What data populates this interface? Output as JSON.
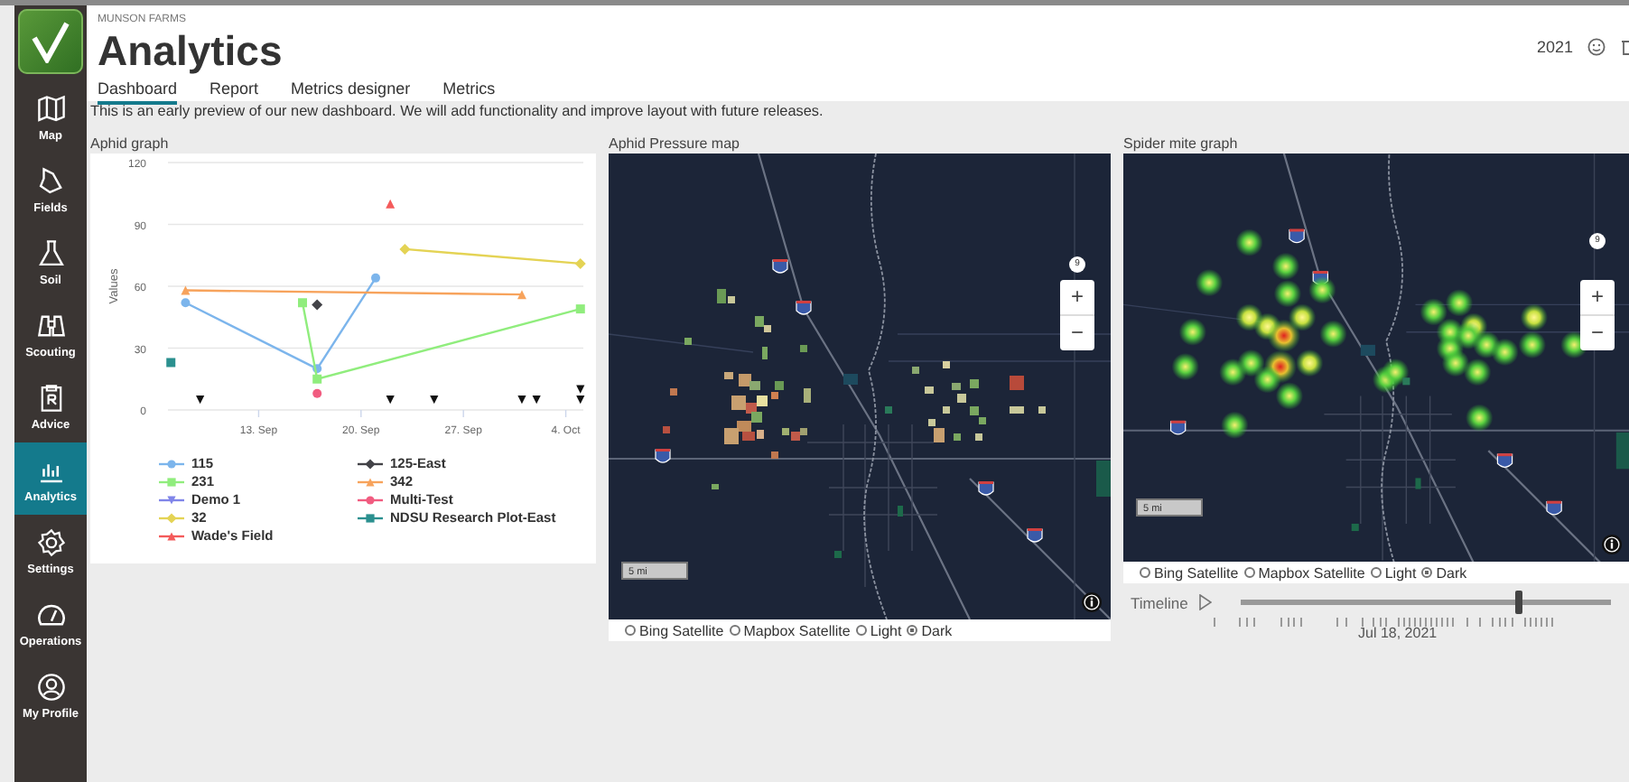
{
  "sidebar": {
    "items": [
      {
        "label": "Map",
        "selected": false
      },
      {
        "label": "Fields",
        "selected": false
      },
      {
        "label": "Soil",
        "selected": false
      },
      {
        "label": "Scouting",
        "selected": false
      },
      {
        "label": "Advice",
        "selected": false
      },
      {
        "label": "Analytics",
        "selected": true
      },
      {
        "label": "Settings",
        "selected": false
      },
      {
        "label": "Operations",
        "selected": false
      },
      {
        "label": "My Profile",
        "selected": false
      }
    ]
  },
  "header": {
    "company": "MUNSON FARMS",
    "title": "Analytics",
    "year": "2021",
    "tabs": [
      {
        "label": "Dashboard",
        "selected": true
      },
      {
        "label": "Report",
        "selected": false
      },
      {
        "label": "Metrics designer",
        "selected": false
      },
      {
        "label": "Metrics",
        "selected": false
      }
    ]
  },
  "notice": "This is an early preview of our new dashboard. We will add functionality and improve layout with future releases.",
  "aphid_graph": {
    "title": "Aphid graph",
    "chart_data": {
      "type": "line",
      "ylabel": "Values",
      "categories": [
        null,
        null,
        null,
        null,
        null,
        null,
        "13. Sep",
        null,
        null,
        null,
        null,
        null,
        null,
        "20. Sep",
        null,
        null,
        null,
        null,
        null,
        null,
        "27. Sep",
        null,
        null,
        null,
        null,
        null,
        null,
        "4. Oct",
        null
      ],
      "ylim": [
        0,
        120
      ],
      "yticks": [
        0,
        30,
        60,
        90,
        120
      ],
      "series": [
        {
          "name": "115",
          "color": "#7cb5ec",
          "marker": "circle",
          "values": [
            null,
            52,
            null,
            null,
            null,
            null,
            null,
            null,
            null,
            null,
            20,
            null,
            null,
            null,
            64,
            null,
            null,
            null,
            null,
            null,
            null,
            null,
            null,
            null,
            null,
            null,
            null,
            null,
            null
          ]
        },
        {
          "name": "125-East",
          "color": "#434348",
          "marker": "diamond",
          "values": [
            null,
            null,
            null,
            null,
            null,
            null,
            null,
            null,
            null,
            null,
            51,
            null,
            null,
            null,
            null,
            null,
            null,
            null,
            null,
            null,
            null,
            null,
            null,
            null,
            null,
            null,
            null,
            null,
            null
          ]
        },
        {
          "name": "231",
          "color": "#90ed7d",
          "marker": "square",
          "values": [
            null,
            null,
            null,
            null,
            null,
            null,
            null,
            null,
            null,
            52,
            15,
            null,
            null,
            null,
            null,
            null,
            null,
            null,
            null,
            null,
            null,
            null,
            null,
            null,
            null,
            null,
            null,
            null,
            49
          ]
        },
        {
          "name": "342",
          "color": "#f7a35c",
          "marker": "triangle",
          "values": [
            null,
            58,
            null,
            null,
            null,
            null,
            null,
            null,
            null,
            null,
            null,
            null,
            null,
            null,
            null,
            null,
            null,
            null,
            null,
            null,
            null,
            null,
            null,
            null,
            56,
            null,
            null,
            null,
            null
          ]
        },
        {
          "name": "Demo 1",
          "color": "#8085e9",
          "marker": "triangle-down",
          "values": [
            null,
            null,
            null,
            null,
            null,
            null,
            null,
            null,
            null,
            null,
            null,
            null,
            null,
            null,
            null,
            null,
            null,
            null,
            null,
            null,
            null,
            null,
            null,
            null,
            null,
            null,
            null,
            null,
            null
          ]
        },
        {
          "name": "Multi-Test",
          "color": "#f15c80",
          "marker": "circle",
          "values": [
            null,
            null,
            null,
            null,
            null,
            null,
            null,
            null,
            null,
            null,
            8,
            null,
            null,
            null,
            null,
            null,
            null,
            null,
            null,
            null,
            null,
            null,
            null,
            null,
            null,
            null,
            null,
            null,
            null
          ]
        },
        {
          "name": "32",
          "color": "#e4d354",
          "marker": "diamond",
          "values": [
            null,
            null,
            null,
            null,
            null,
            null,
            null,
            null,
            null,
            null,
            null,
            null,
            null,
            null,
            null,
            null,
            78,
            null,
            null,
            null,
            null,
            null,
            null,
            null,
            null,
            null,
            null,
            null,
            71
          ]
        },
        {
          "name": "NDSU Research Plot-East",
          "color": "#2b908f",
          "marker": "square",
          "values": [
            23,
            null,
            null,
            null,
            null,
            null,
            null,
            null,
            null,
            null,
            null,
            null,
            null,
            null,
            null,
            null,
            null,
            null,
            null,
            null,
            null,
            null,
            null,
            null,
            null,
            null,
            null,
            null,
            null
          ]
        },
        {
          "name": "Wade's Field",
          "color": "#f45b5b",
          "marker": "triangle",
          "values": [
            null,
            null,
            null,
            null,
            null,
            null,
            null,
            null,
            null,
            null,
            null,
            null,
            null,
            null,
            null,
            100,
            null,
            null,
            null,
            null,
            null,
            null,
            null,
            null,
            null,
            null,
            null,
            null,
            null
          ]
        },
        {
          "type": "scatter",
          "color": "#111111",
          "marker": "triangle-down",
          "values": [
            null,
            null,
            5,
            null,
            null,
            null,
            null,
            null,
            null,
            null,
            null,
            null,
            null,
            null,
            null,
            5,
            null,
            null,
            5,
            null,
            null,
            null,
            null,
            null,
            5,
            5,
            null,
            null,
            5
          ]
        },
        {
          "type": "scatter",
          "color": "#111111",
          "marker": "triangle-down",
          "values": [
            null,
            null,
            null,
            null,
            null,
            null,
            null,
            null,
            null,
            null,
            null,
            null,
            null,
            null,
            null,
            null,
            null,
            null,
            null,
            null,
            null,
            null,
            null,
            null,
            null,
            null,
            null,
            null,
            10
          ]
        }
      ],
      "grid": true
    }
  },
  "maps": [
    {
      "title": "Aphid Pressure map",
      "kind": "fields",
      "zoom_badge": "9",
      "zoom_in": "+",
      "zoom_out": "−",
      "scale": "5 mi",
      "basemaps": [
        {
          "label": "Bing Satellite",
          "selected": false
        },
        {
          "label": "Mapbox Satellite",
          "selected": false
        },
        {
          "label": "Light",
          "selected": false
        },
        {
          "label": "Dark",
          "selected": true
        }
      ]
    },
    {
      "title": "Spider mite graph",
      "kind": "heat",
      "zoom_badge": "9",
      "zoom_in": "+",
      "zoom_out": "−",
      "scale": "5 mi",
      "basemaps": [
        {
          "label": "Bing Satellite",
          "selected": false
        },
        {
          "label": "Mapbox Satellite",
          "selected": false
        },
        {
          "label": "Light",
          "selected": false
        },
        {
          "label": "Dark",
          "selected": true
        }
      ],
      "timeline": {
        "label": "Timeline",
        "level": 0.75,
        "date": "Jul 18, 2021"
      }
    }
  ]
}
